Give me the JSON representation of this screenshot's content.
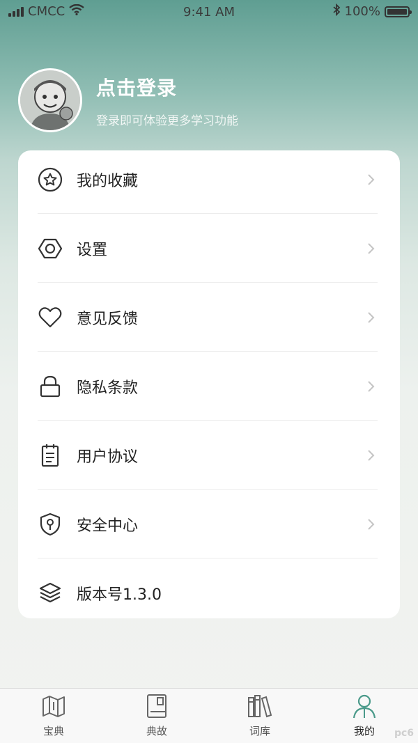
{
  "status_bar": {
    "carrier": "CMCC",
    "time": "9:41 AM",
    "battery": "100%",
    "battery_level": 1.0
  },
  "profile": {
    "title": "点击登录",
    "subtitle": "登录即可体验更多学习功能"
  },
  "menu": {
    "items": [
      {
        "label": "我的收藏",
        "icon": "star-circle-icon"
      },
      {
        "label": "设置",
        "icon": "hexagon-settings-icon"
      },
      {
        "label": "意见反馈",
        "icon": "heart-icon"
      },
      {
        "label": "隐私条款",
        "icon": "lock-icon"
      },
      {
        "label": "用户协议",
        "icon": "notepad-icon"
      },
      {
        "label": "安全中心",
        "icon": "shield-key-icon"
      },
      {
        "label": "版本号1.3.0",
        "icon": "layers-icon"
      }
    ]
  },
  "tabbar": {
    "tabs": [
      {
        "label": "宝典",
        "icon": "map-icon"
      },
      {
        "label": "典故",
        "icon": "book-icon"
      },
      {
        "label": "词库",
        "icon": "library-icon"
      },
      {
        "label": "我的",
        "icon": "person-icon"
      }
    ],
    "active_index": 3
  },
  "colors": {
    "header_green": "#5f9e92",
    "accent": "#4a9a8a"
  },
  "watermark": "pc6"
}
